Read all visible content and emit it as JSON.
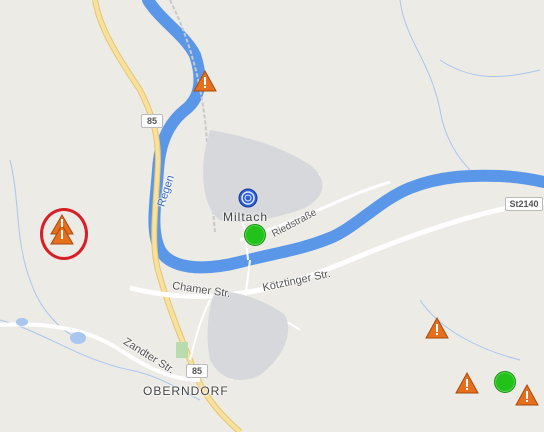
{
  "map": {
    "place_labels": {
      "town_main": "Miltach",
      "town_secondary": "OBERNDORF"
    },
    "street_labels": {
      "river": "Regen",
      "riedstrasse": "Riedstraße",
      "chamer": "Chamer Str.",
      "koetztinger": "Kötztinger Str.",
      "zandter": "Zandter Str."
    },
    "road_shields": {
      "b85_north": "85",
      "b85_south": "85",
      "st2140": "St2140"
    },
    "markers": [
      {
        "type": "warning",
        "icon": "warning-triangle-icon"
      },
      {
        "type": "warning-stack",
        "icon": "warning-triangle-icon",
        "highlighted": true
      },
      {
        "type": "current-location",
        "icon": "location-target-icon"
      },
      {
        "type": "station",
        "icon": "green-dot-icon"
      },
      {
        "type": "warning",
        "icon": "warning-triangle-icon"
      },
      {
        "type": "warning",
        "icon": "warning-triangle-icon"
      },
      {
        "type": "station",
        "icon": "green-dot-icon"
      },
      {
        "type": "warning",
        "icon": "warning-triangle-icon"
      }
    ],
    "colors": {
      "land": "#ecebe6",
      "water": "#5a97e8",
      "highway": "#f3d98a",
      "road": "#ffffff",
      "warning": "#e56f1c",
      "station": "#22c21a",
      "highlight": "#d61f26"
    }
  }
}
